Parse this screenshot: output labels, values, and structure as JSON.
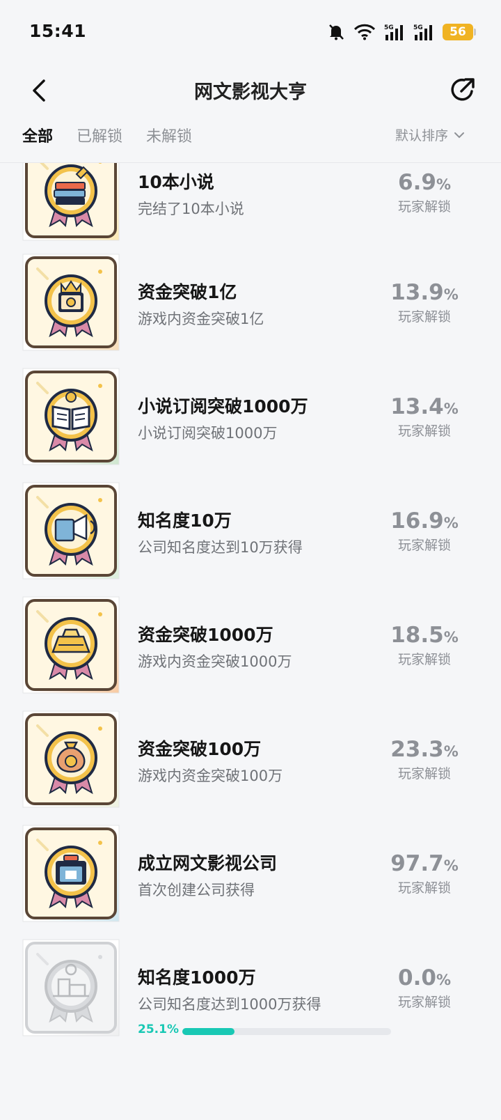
{
  "status_bar": {
    "time": "15:41",
    "battery": "56"
  },
  "header": {
    "title": "网文影视大亨"
  },
  "tabs": [
    {
      "label": "全部",
      "active": true
    },
    {
      "label": "已解锁",
      "active": false
    },
    {
      "label": "未解锁",
      "active": false
    }
  ],
  "sort": {
    "label": "默认排序"
  },
  "unlock_label": "玩家解锁",
  "percent_unit": "%",
  "achievements": [
    {
      "name": "10本小说",
      "desc": "完结了10本小说",
      "percent": "6.9",
      "icon": "books-pencil-icon",
      "locked": false
    },
    {
      "name": "资金突破1亿",
      "desc": "游戏内资金突破1亿",
      "percent": "13.9",
      "icon": "crown-safe-icon",
      "locked": false
    },
    {
      "name": "小说订阅突破1000万",
      "desc": "小说订阅突破1000万",
      "percent": "13.4",
      "icon": "open-book-icon",
      "locked": false
    },
    {
      "name": "知名度10万",
      "desc": "公司知名度达到10万获得",
      "percent": "16.9",
      "icon": "megaphone-icon",
      "locked": false
    },
    {
      "name": "资金突破1000万",
      "desc": "游戏内资金突破1000万",
      "percent": "18.5",
      "icon": "gold-ingot-icon",
      "locked": false
    },
    {
      "name": "资金突破100万",
      "desc": "游戏内资金突破100万",
      "percent": "23.3",
      "icon": "money-bag-icon",
      "locked": false
    },
    {
      "name": "成立网文影视公司",
      "desc": "首次创建公司获得",
      "percent": "97.7",
      "icon": "company-box-icon",
      "locked": false
    },
    {
      "name": "知名度1000万",
      "desc": "公司知名度达到1000万获得",
      "percent": "0.0",
      "icon": "trophy-stage-icon",
      "locked": true,
      "progress_text": "25.1%",
      "progress": 0.251
    }
  ],
  "colors": {
    "badge_frame": "#5a4636",
    "badge_gold": "#f3c24a",
    "badge_navy": "#1f2a44",
    "progress": "#19c8b4",
    "locked": "#c9cbce"
  }
}
